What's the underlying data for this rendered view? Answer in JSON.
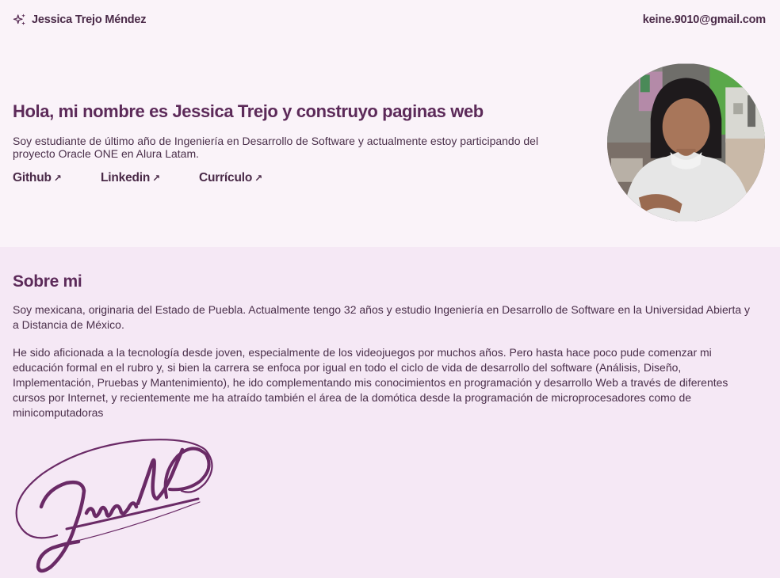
{
  "header": {
    "brand_name": "Jessica Trejo Méndez",
    "brand_icon": "sparkles-icon",
    "email": "keine.9010@gmail.com"
  },
  "hero": {
    "title": "Hola, mi nombre es Jessica Trejo y construyo paginas web",
    "intro": "Soy estudiante de último año de Ingeniería en Desarrollo de Software y actualmente estoy participando del proyecto Oracle ONE en Alura Latam.",
    "links": [
      {
        "label": "Github",
        "icon": "arrow-up-right-icon"
      },
      {
        "label": "Linkedin",
        "icon": "arrow-up-right-icon"
      },
      {
        "label": "Currículo",
        "icon": "arrow-up-right-icon"
      }
    ],
    "arrow_glyph": "↗"
  },
  "about": {
    "title": "Sobre mi",
    "paragraph1": "Soy mexicana, originaria del Estado de Puebla. Actualmente tengo 32 años y estudio Ingeniería en Desarrollo de Software en la Universidad Abierta y a Distancia de México.",
    "paragraph2": "He sido aficionada a la tecnología desde joven, especialmente de los videojuegos por muchos años. Pero hasta hace poco pude comenzar mi educación formal en el rubro y, si bien la carrera se enfoca por igual en todo el ciclo de vida de desarrollo del software (Análisis, Diseño, Implementación, Pruebas y Mantenimiento), he ido complementando mis conocimientos en programación y desarrollo Web a través de diferentes cursos por Internet, y recientemente me ha atraído también el área de la domótica desde la programación de microprocesadores como de minicomputadoras"
  },
  "colors": {
    "page_bg": "#faf3f9",
    "about_bg": "#f5e8f5",
    "accent": "#5c2a59",
    "signature": "#6a2a66"
  }
}
